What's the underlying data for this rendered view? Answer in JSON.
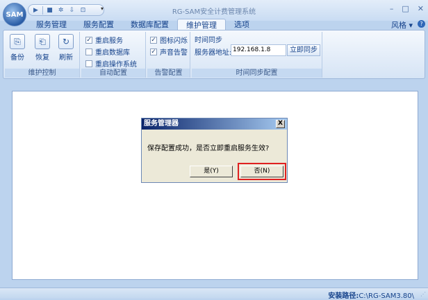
{
  "window": {
    "title": "RG-SAM安全计费管理系统",
    "logo": "SAM",
    "style_label": "风格",
    "help_icon": "?"
  },
  "qat": {
    "icons": [
      "play-icon",
      "stop-icon",
      "settings-icon",
      "download-icon",
      "save-icon"
    ],
    "dropdown": "▾"
  },
  "tabs": [
    "服务管理",
    "服务配置",
    "数据库配置",
    "维护管理",
    "选项"
  ],
  "active_tab": "维护管理",
  "ribbon": {
    "maintain": {
      "caption": "维护控制",
      "backup": "备份",
      "restore": "恢复",
      "refresh": "刷新"
    },
    "restart": {
      "caption": "自动配置",
      "restart_service": "重启服务",
      "restart_db": "重启数据库",
      "restart_os": "重启操作系统",
      "checked": [
        true,
        false,
        false
      ]
    },
    "alarm": {
      "caption": "告警配置",
      "icon_flash": "图标闪烁",
      "sound_alarm": "声音告警",
      "checked": [
        true,
        true
      ]
    },
    "sync": {
      "caption": "时间同步配置",
      "title": "时间同步",
      "server_label": "服务器地址:",
      "server_value": "192.168.1.8",
      "sync_button": "立即同步"
    }
  },
  "dialog": {
    "title": "服务管理器",
    "message": "保存配置成功，是否立即重启服务生效?",
    "yes": "是(Y)",
    "no": "否(N)",
    "close": "X"
  },
  "statusbar": {
    "install_label": "安装路径:",
    "install_path": "C:\\RG-SAM3.80\\"
  }
}
